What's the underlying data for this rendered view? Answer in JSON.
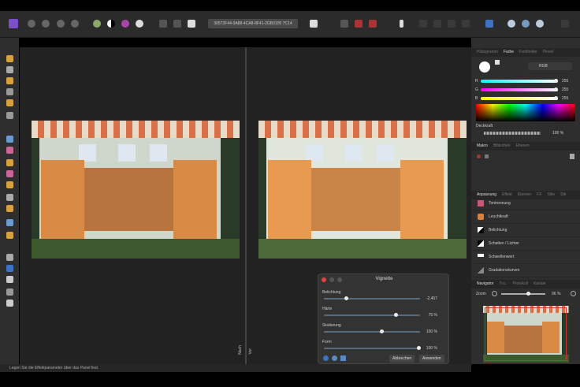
{
  "toolbar": {
    "document_id": "30572F44-3A88-4CA8-8F41-2GB3105 7C14"
  },
  "canvas": {
    "left_label": "Nach",
    "right_label": "Vor"
  },
  "panel": {
    "color_tabs": [
      "Histogramm",
      "Farbe",
      "Farbfelder",
      "Pinsel"
    ],
    "active_color_tab": "Farbe",
    "color_model": "RGB",
    "channels": [
      {
        "label": "R",
        "value": "255"
      },
      {
        "label": "G",
        "value": "255"
      },
      {
        "label": "B",
        "value": "255"
      }
    ],
    "opacity_label": "Deckkraft",
    "opacity_value": "100 %",
    "macro_tabs": [
      "Makro",
      "Bibliothek",
      "Ebenen"
    ],
    "adjust_tabs": [
      "Anpassung",
      "Effekt",
      "Ebenen",
      "FX",
      "Stile",
      "Stk"
    ],
    "adjustments": [
      "Tontrennung",
      "Leuchtkraft",
      "Belichtung",
      "Schatten / Lichter",
      "Schwellenwert",
      "Gradationskurven"
    ],
    "nav_tabs": [
      "Navigator",
      "Tra..",
      "Protokoll",
      "Kanäle"
    ],
    "zoom_label": "Zoom",
    "zoom_value": "96 %"
  },
  "dialog": {
    "title": "Vignette",
    "params": [
      {
        "label": "Belichtung",
        "value": "-2,457",
        "level": 0.22
      },
      {
        "label": "Härte",
        "value": "75 %",
        "level": 0.75
      },
      {
        "label": "Skalierung",
        "value": "100 %",
        "level": 0.6
      },
      {
        "label": "Form",
        "value": "100 %",
        "level": 1.0
      }
    ],
    "cancel": "Abbrechen",
    "apply": "Anwenden"
  },
  "status": "Legen Sie die Effektparameter über das Panel fest.",
  "colors": {
    "accent": "#7b4fc9",
    "close": "#e0443e"
  }
}
